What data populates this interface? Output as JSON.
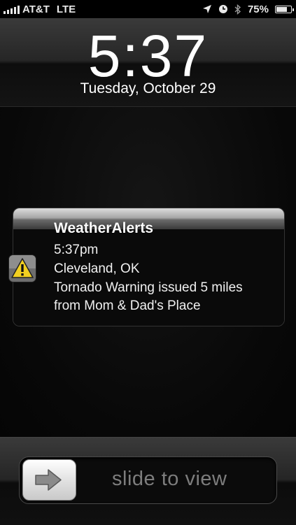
{
  "status_bar": {
    "carrier": "AT&T",
    "network": "LTE",
    "battery_text": "75%",
    "battery_level": 0.75,
    "icons": [
      "location-arrow-icon",
      "alarm-clock-icon",
      "bluetooth-icon",
      "battery-icon"
    ]
  },
  "lock_screen": {
    "time": "5:37",
    "date": "Tuesday, October 29"
  },
  "notification": {
    "app_name": "WeatherAlerts",
    "app_icon": "warning-triangle-icon",
    "lines": [
      "5:37pm",
      "Cleveland, OK",
      "Tornado Warning issued 5 miles",
      "from Mom & Dad's Place"
    ]
  },
  "slider": {
    "label": "slide to view",
    "knob_icon": "arrow-right-icon"
  },
  "colors": {
    "warning_yellow": "#f2d020",
    "slider_text": "#7d7d7d"
  }
}
